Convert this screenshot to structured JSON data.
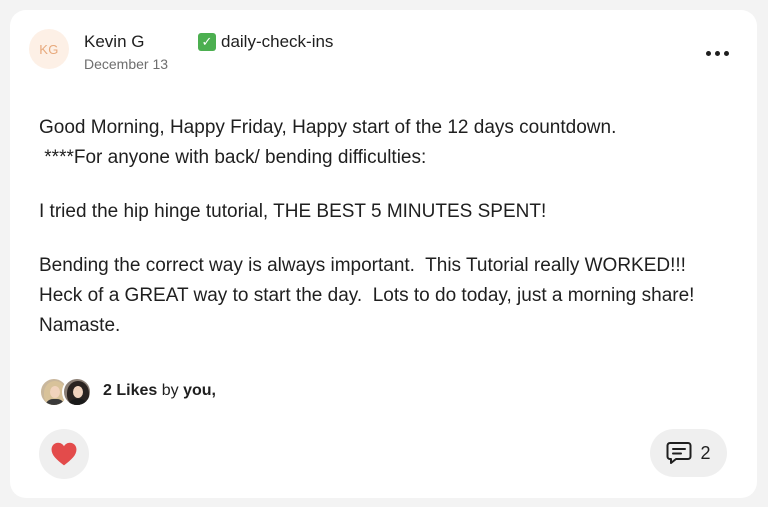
{
  "post": {
    "author": {
      "initials": "KG",
      "name": "Kevin G",
      "date": "December 13"
    },
    "channel": {
      "icon": "check-mark-emoji-icon",
      "name": "daily-check-ins"
    },
    "body": {
      "line1": "Good Morning, Happy Friday, Happy start of the 12 days countdown.",
      "line2": " ****For anyone with back/ bending difficulties:",
      "para2": "I tried the hip hinge tutorial, THE BEST 5 MINUTES SPENT!",
      "para3": "Bending the correct way is always important.  This Tutorial really WORKED!!!  Heck of a GREAT way to start the day.  Lots to do today, just a morning share!  Namaste."
    },
    "likes": {
      "count_label": "2 Likes",
      "by_label": "by",
      "names": "you,"
    },
    "actions": {
      "like_icon": "heart-icon",
      "comment_icon": "comment-icon",
      "comment_count": "2"
    }
  },
  "colors": {
    "heart": "#e34b4b",
    "avatar_bg": "#fdf0e6",
    "avatar_text": "#e7a97c",
    "check_bg": "#4caf50"
  }
}
